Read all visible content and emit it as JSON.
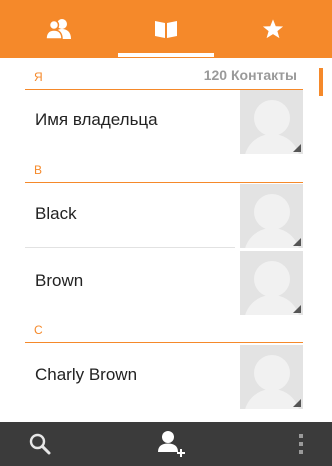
{
  "tabs": [
    {
      "icon": "contacts-group-icon"
    },
    {
      "icon": "book-icon"
    },
    {
      "icon": "star-icon"
    }
  ],
  "selected_tab_index": 1,
  "accent_color": "#f5892a",
  "sections": {
    "ya": {
      "letter": "Я",
      "count_label": "120 Контакты"
    },
    "v": {
      "letter": "В"
    },
    "s": {
      "letter": "С"
    }
  },
  "contacts": {
    "owner": {
      "name": "Имя владельца"
    },
    "black": {
      "name": "Black"
    },
    "brown": {
      "name": "Brown"
    },
    "charly": {
      "name": "Charly Brown"
    }
  },
  "bottom_bar": {
    "buttons": [
      {
        "icon": "search-icon"
      },
      {
        "icon": "add-contact-icon"
      },
      {
        "icon": "overflow-menu-icon"
      }
    ]
  }
}
